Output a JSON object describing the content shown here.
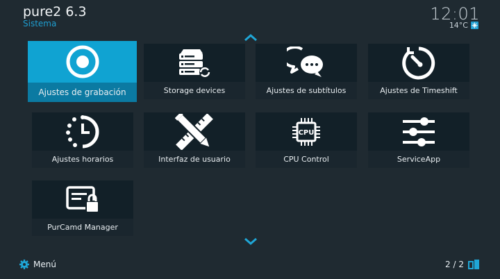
{
  "header": {
    "title": "pure2 6.3",
    "subtitle": "Sistema",
    "clock": "12:01",
    "temperature": "14°C",
    "weather_icon": "snowflake-icon"
  },
  "tiles": [
    {
      "label": "Ajustes de grabación",
      "icon": "record-icon",
      "selected": true
    },
    {
      "label": "Storage devices",
      "icon": "storage-icon"
    },
    {
      "label": "Ajustes de subtítulos",
      "icon": "subtitles-chat-icon"
    },
    {
      "label": "Ajustes de Timeshift",
      "icon": "timeshift-icon"
    },
    {
      "label": "Ajustes horarios",
      "icon": "clock-icon"
    },
    {
      "label": "Interfaz de usuario",
      "icon": "pencil-ruler-icon"
    },
    {
      "label": "CPU Control",
      "icon": "cpu-icon",
      "icon_text": "CPU"
    },
    {
      "label": "ServiceApp",
      "icon": "sliders-icon"
    },
    {
      "label": "PurCamd Manager",
      "icon": "locked-card-icon"
    }
  ],
  "footer": {
    "menu_label": "Menú",
    "page": "2 / 2"
  },
  "colors": {
    "background": "#1f2a31",
    "accent": "#10a3d2",
    "tile": "#122028",
    "label_bar": "#1a262e"
  }
}
